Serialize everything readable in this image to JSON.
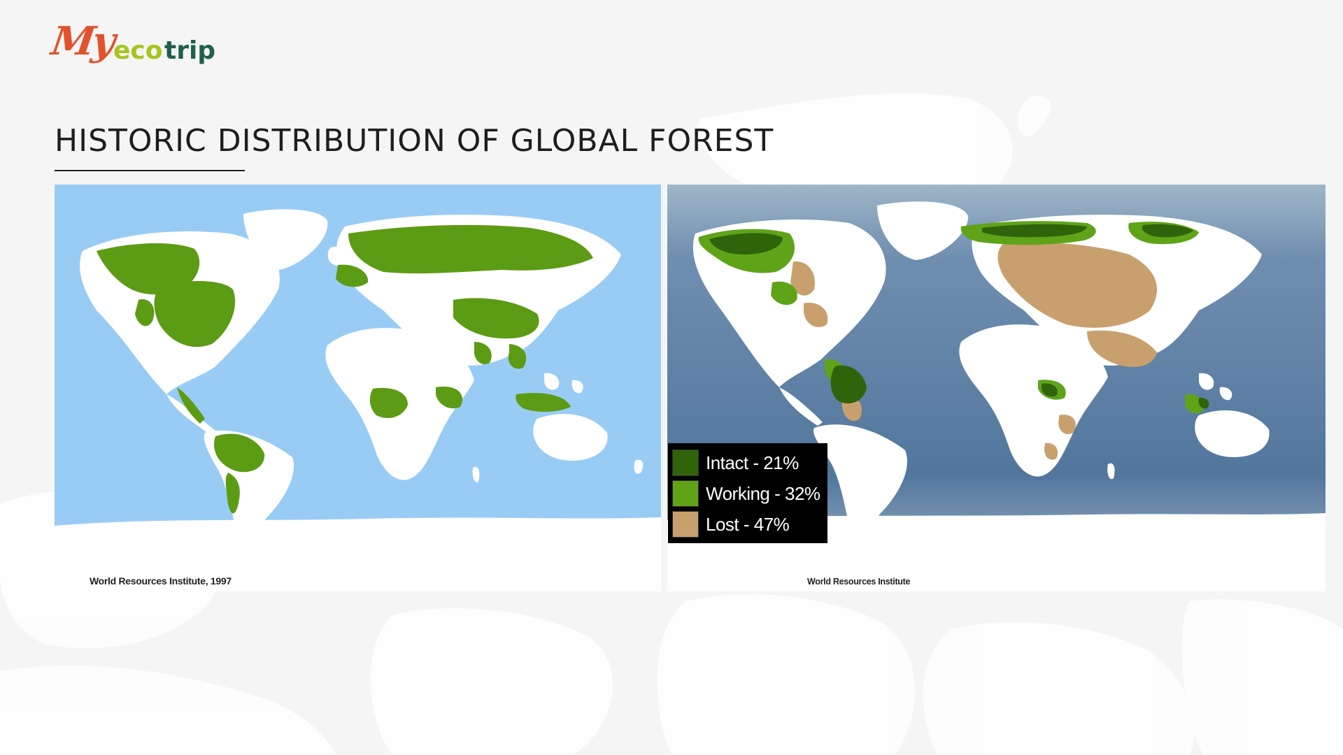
{
  "brand": {
    "logo_my": "My",
    "logo_eco": "eco",
    "logo_trip": "trip"
  },
  "slide": {
    "title": "HISTORIC DISTRIBUTION OF GLOBAL FOREST"
  },
  "maps": {
    "left": {
      "caption": "World Resources Institute, 1997",
      "ocean_color": "#99ccf5",
      "forest_color": "#5c9b14"
    },
    "right": {
      "caption": "World Resources Institute",
      "ocean_color": "#5b7fa3",
      "legend": [
        {
          "label": "Intact - 21%",
          "color": "#2f640a"
        },
        {
          "label": "Working - 32%",
          "color": "#5fa319"
        },
        {
          "label": "Lost - 47%",
          "color": "#c8a06d"
        }
      ]
    }
  },
  "colors": {
    "logo_red": "#e2532d",
    "logo_lime": "#a6c51e",
    "logo_green": "#1f5f4c",
    "title": "#1e1e1e",
    "background": "#f5f5f5"
  }
}
